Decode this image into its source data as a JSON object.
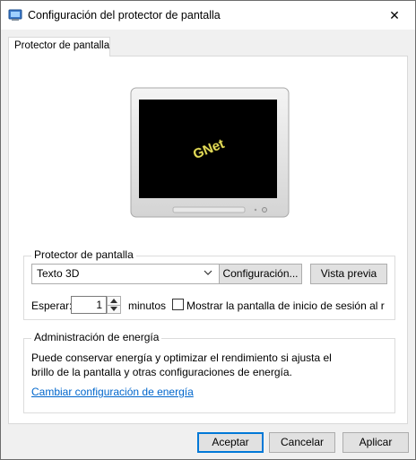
{
  "window": {
    "title": "Configuración del protector de pantalla",
    "close_glyph": "✕"
  },
  "tabs": [
    {
      "label": "Protector de pantalla",
      "selected": true
    }
  ],
  "preview": {
    "screen_text": "GNet",
    "screen_text_color": "#e8e060",
    "screen_color": "#000000"
  },
  "screensaver_group": {
    "label": "Protector de pantalla",
    "selected_screensaver": "Texto 3D",
    "settings_button": "Configuración...",
    "preview_button": "Vista previa",
    "wait_label": "Esperar:",
    "wait_value": "1",
    "minutes_label": "minutos",
    "logon_checkbox_label": "Mostrar la pantalla de inicio de sesión al re",
    "logon_checked": false
  },
  "power_group": {
    "label": "Administración de energía",
    "line1": "Puede conservar energía y optimizar el rendimiento si ajusta el",
    "line2": "brillo de la pantalla y otras configuraciones de energía.",
    "link": "Cambiar configuración de energía"
  },
  "footer": {
    "ok": "Aceptar",
    "cancel": "Cancelar",
    "apply": "Aplicar"
  },
  "colors": {
    "accent": "#0078d7",
    "link": "#0066cc"
  }
}
